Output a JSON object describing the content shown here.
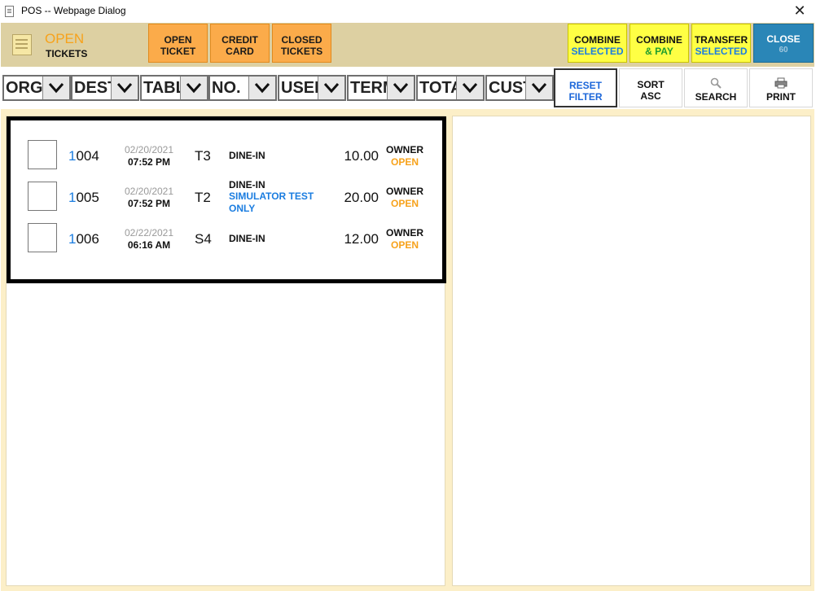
{
  "window": {
    "title": "POS -- Webpage Dialog",
    "close": "✕"
  },
  "header": {
    "title": "OPEN",
    "subtitle": "TICKETS",
    "buttons": {
      "open_ticket": [
        "OPEN",
        "TICKET"
      ],
      "credit_card": [
        "CREDIT",
        "CARD"
      ],
      "closed_tickets": [
        "CLOSED",
        "TICKETS"
      ],
      "combine_selected": [
        "COMBINE",
        "SELECTED"
      ],
      "combine_pay": [
        "COMBINE",
        "& PAY"
      ],
      "transfer_selected": [
        "TRANSFER",
        "SELECTED"
      ],
      "close": [
        "CLOSE",
        "60"
      ]
    }
  },
  "filters": [
    {
      "label": "ORG"
    },
    {
      "label": "DEST"
    },
    {
      "label": "TABLE"
    },
    {
      "label": "NO."
    },
    {
      "label": "USER"
    },
    {
      "label": "TERM"
    },
    {
      "label": "TOTAL"
    },
    {
      "label": "CUST"
    }
  ],
  "actions": {
    "reset": [
      "RESET",
      "FILTER"
    ],
    "sort": [
      "SORT",
      "ASC"
    ],
    "search": "SEARCH",
    "print": "PRINT"
  },
  "tickets": [
    {
      "num_first": "1",
      "num_rest": "004",
      "date": "02/20/2021",
      "time": "07:52 PM",
      "table": "T3",
      "type": "DINE-IN",
      "note": "",
      "amount": "10.00",
      "owner": "OWNER",
      "status": "OPEN"
    },
    {
      "num_first": "1",
      "num_rest": "005",
      "date": "02/20/2021",
      "time": "07:52 PM",
      "table": "T2",
      "type": "DINE-IN",
      "note": "SIMULATOR TEST ONLY",
      "amount": "20.00",
      "owner": "OWNER",
      "status": "OPEN"
    },
    {
      "num_first": "1",
      "num_rest": "006",
      "date": "02/22/2021",
      "time": "06:16 AM",
      "table": "S4",
      "type": "DINE-IN",
      "note": "",
      "amount": "12.00",
      "owner": "OWNER",
      "status": "OPEN"
    }
  ],
  "colors": {
    "accent_orange": "#f7a21b",
    "accent_blue": "#1b7de0",
    "header_bg": "#ddd0a2",
    "content_bg": "#fcefc8"
  }
}
